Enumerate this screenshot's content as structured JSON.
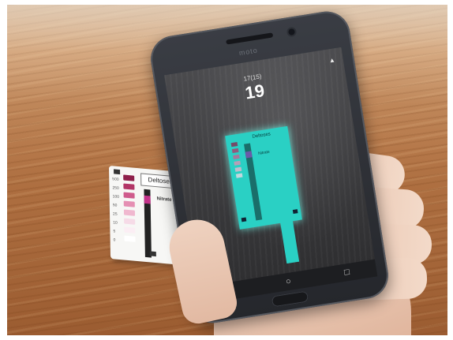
{
  "scene": {
    "card": {
      "title": "Deltoses",
      "subtitle": "Nitrate",
      "scale_marks": [
        "500",
        "250",
        "100",
        "50",
        "25",
        "10",
        "5",
        "0"
      ],
      "pad_colors": [
        "#8e1f4a",
        "#b23566",
        "#cf5b8c",
        "#e58fb3",
        "#f0b8cf",
        "#f6dbe7",
        "#fbeef4",
        "#ffffff"
      ],
      "stick_pad_color": "#c4338a"
    },
    "phone": {
      "brand": "moto",
      "timer_label": "17(15)",
      "timer_value": "19",
      "ar_title": "Deltoses",
      "ar_subtitle": "Nitrate",
      "ar_color": "#2ad0c4",
      "nav": {
        "back": "◁",
        "home": "○",
        "recents": "□"
      }
    }
  }
}
